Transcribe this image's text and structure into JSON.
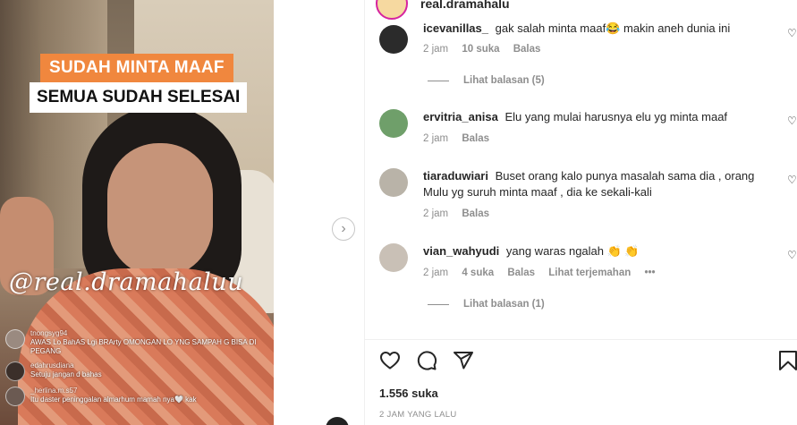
{
  "post": {
    "username": "real.dramahalu",
    "likes": "1.556 suka",
    "time_ago": "2 JAM YANG LALU"
  },
  "media": {
    "caption_top": "SUDAH MINTA MAAF",
    "caption_bottom": "SEMUA SUDAH SELESAI",
    "watermark": "@real.dramahaluu",
    "live_comments": [
      {
        "user": "tnongsyg94",
        "text": "AWAS Lo BahAS Lgi BRArty OMONGAN LO YNG SAMPAH G BISA DI PEGANG"
      },
      {
        "user": "edahrusdiana",
        "text": "Setuju jangan d bahas"
      },
      {
        "user": "_herlina.m.s57",
        "text": "Itu daster peninggalan almarhum mamah nya🤍 kak"
      }
    ]
  },
  "comments": [
    {
      "user": "icevanillas_",
      "text": "gak salah minta maaf😂 makin aneh dunia ini",
      "time": "2 jam",
      "likes": "10 suka",
      "reply": "Balas",
      "view_replies": "Lihat balasan (5)"
    },
    {
      "user": "ervitria_anisa",
      "text": "Elu yang mulai harusnya elu yg minta maaf",
      "time": "2 jam",
      "reply": "Balas"
    },
    {
      "user": "tiaraduwiari",
      "text": "Buset orang kalo punya masalah sama dia , orang Mulu yg suruh minta maaf , dia ke sekali-kali",
      "time": "2 jam",
      "reply": "Balas"
    },
    {
      "user": "vian_wahyudi",
      "text": "yang waras ngalah 👏 👏",
      "time": "2 jam",
      "likes": "4 suka",
      "reply": "Balas",
      "translate": "Lihat terjemahan",
      "more": "•••",
      "view_replies": "Lihat balasan (1)"
    }
  ],
  "icons": {
    "next": "›",
    "heart": "♡"
  }
}
